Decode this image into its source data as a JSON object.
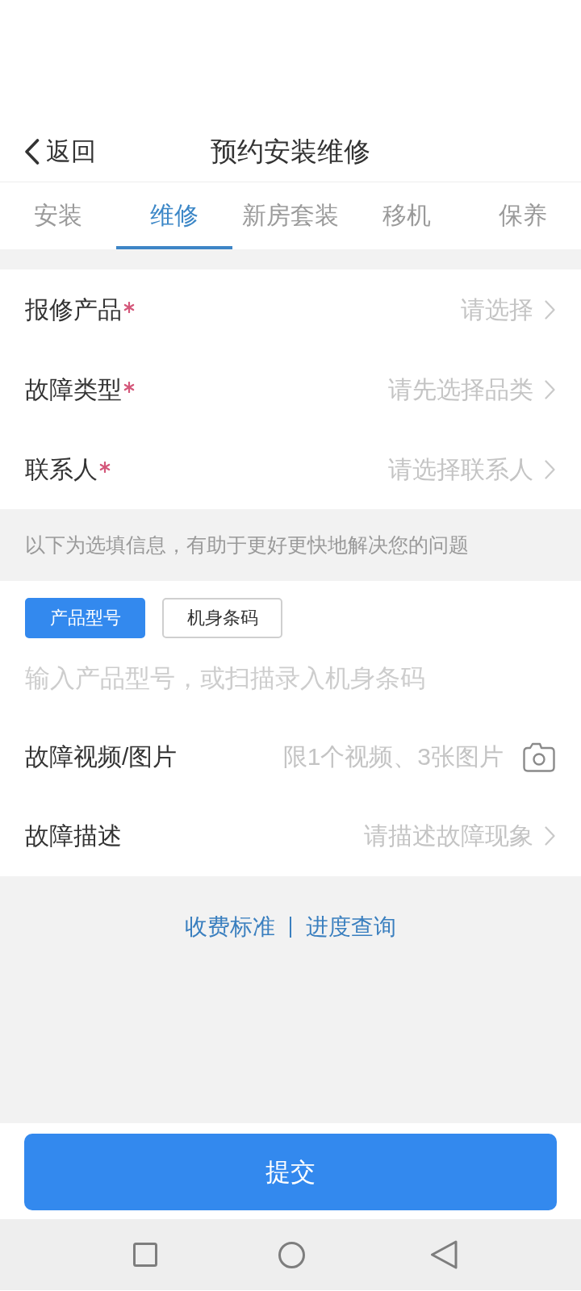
{
  "header": {
    "back_label": "返回",
    "title": "预约安装维修"
  },
  "tabs": [
    {
      "label": "安装",
      "selected": false
    },
    {
      "label": "维修",
      "selected": true
    },
    {
      "label": "新房套装",
      "selected": false
    },
    {
      "label": "移机",
      "selected": false
    },
    {
      "label": "保养",
      "selected": false
    }
  ],
  "required_fields": [
    {
      "kind": "select",
      "label": "报修产品",
      "required": true,
      "placeholder": "请选择"
    },
    {
      "kind": "select",
      "label": "故障类型",
      "required": true,
      "placeholder": "请先选择品类"
    },
    {
      "kind": "select",
      "label": "联系人",
      "required": true,
      "placeholder": "请选择联系人"
    }
  ],
  "optional_note": "以下为选填信息，有助于更好更快地解决您的问题",
  "input_modes": [
    {
      "label": "产品型号",
      "selected": true
    },
    {
      "label": "机身条码",
      "selected": false
    }
  ],
  "model_input": {
    "placeholder": "输入产品型号，或扫描录入机身条码"
  },
  "optional_fields": [
    {
      "kind": "upload",
      "label": "故障视频/图片",
      "required": false,
      "placeholder": "限1个视频、3张图片"
    },
    {
      "kind": "select",
      "label": "故障描述",
      "required": false,
      "placeholder": "请描述故障现象"
    }
  ],
  "links": [
    {
      "label": "收费标准"
    },
    {
      "label": "进度查询"
    }
  ],
  "submit": {
    "label": "提交"
  }
}
